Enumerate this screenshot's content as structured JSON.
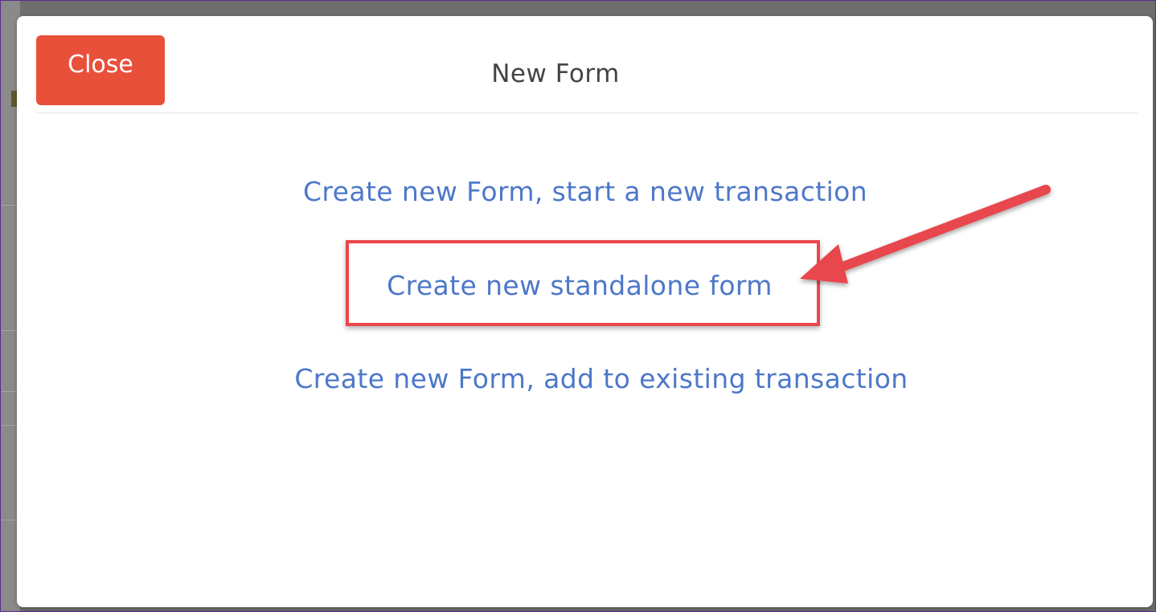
{
  "modal": {
    "close_label": "Close",
    "title": "New Form",
    "options": [
      "Create new Form, start a new transaction",
      "Create new standalone form",
      "Create new Form, add to existing transaction"
    ]
  },
  "colors": {
    "close_button": "#e8503a",
    "link": "#4d78c9",
    "annotation": "#e8474d"
  }
}
